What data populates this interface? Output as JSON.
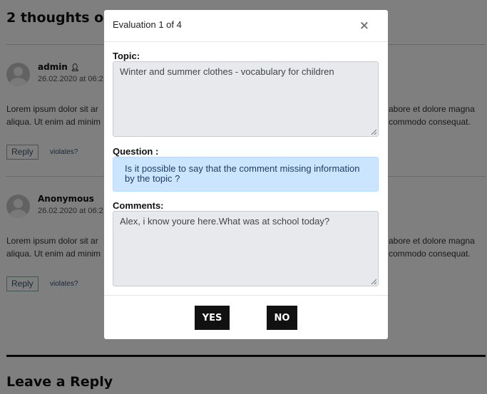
{
  "page": {
    "comments_title": "2 thoughts on",
    "comments": [
      {
        "author": "admin",
        "date": "26.02.2020 at 06:2",
        "text_left_1": "Lorem ipsum dolor sit ar",
        "text_left_2": "aliqua. Ut enim ad minim",
        "text_right_1": "abore et dolore magna",
        "text_right_2": "commodo consequat.",
        "reply_label": "Reply",
        "violates_label": "violates?"
      },
      {
        "author": "Anonymous",
        "date": "26.02.2020 at 06:2",
        "text_left_1": "Lorem ipsum dolor sit ar",
        "text_left_2": "aliqua. Ut enim ad minim",
        "text_right_1": "abore et dolore magna",
        "text_right_2": "commodo consequat.",
        "reply_label": "Reply",
        "violates_label": "violates?"
      }
    ],
    "leave_reply_title": "Leave a Reply"
  },
  "modal": {
    "title": "Evaluation 1 of 4",
    "close_glyph": "×",
    "topic_label": "Topic:",
    "topic_value": "Winter and summer clothes - vocabulary for children",
    "question_label": "Question :",
    "question_line_1": "Is it possible to say that the comment missing information",
    "question_line_2": "by the topic ?",
    "comments_label": "Comments:",
    "comments_value": "Alex, i know youre here.What was at school today?",
    "yes_label": "YES",
    "no_label": "NO"
  },
  "icons": {
    "user": "user-icon",
    "close": "close-icon",
    "resize": "resize-grip-icon",
    "avatar": "default-avatar"
  },
  "colors": {
    "overlay": "rgba(0,0,0,0.5)",
    "field_bg": "#e7e9ec",
    "question_bg": "#cce5ff",
    "question_text": "#1f3d63",
    "button_bg": "#111111"
  }
}
